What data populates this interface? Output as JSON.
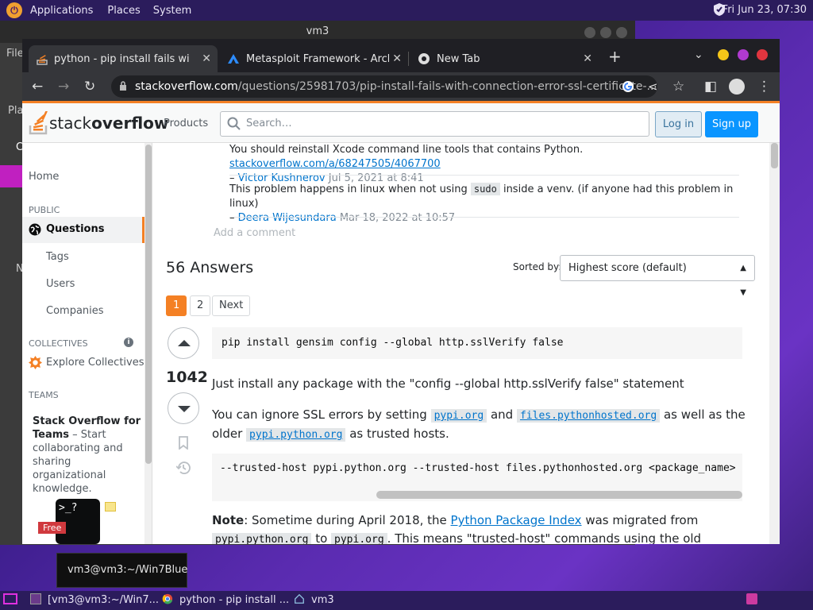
{
  "top_panel": {
    "applications": "Applications",
    "places": "Places",
    "system": "System",
    "clock": "Fri Jun 23, 07:30"
  },
  "vm3_window": {
    "title": "vm3",
    "side_labels": [
      "File",
      "Pla",
      "C",
      "N"
    ]
  },
  "chrome": {
    "tabs": [
      {
        "title": "python - pip install fails with \"c",
        "icon": "stackoverflow-icon"
      },
      {
        "title": "Metasploit Framework - Archi",
        "icon": "metasploit-icon"
      },
      {
        "title": "New Tab",
        "icon": "chrome-icon"
      }
    ],
    "url_host": "stackoverflow.com",
    "url_path": "/questions/25981703/pip-install-fails-with-connection-error-ssl-certificate-..."
  },
  "so": {
    "logo_light": "stack",
    "logo_bold": "overflow",
    "products": "Products",
    "search_placeholder": "Search…",
    "login": "Log in",
    "signup": "Sign up",
    "nav": {
      "home": "Home",
      "public": "PUBLIC",
      "questions": "Questions",
      "tags": "Tags",
      "users": "Users",
      "companies": "Companies",
      "collectives": "COLLECTIVES",
      "explore_collectives": "Explore Collectives",
      "teams": "TEAMS",
      "teams_title": "Stack Overflow for Teams",
      "teams_desc": "– Start collaborating and sharing organizational knowledge.",
      "free": "Free",
      "teams_prompt": ">_?"
    },
    "comments": [
      {
        "text": "You should reinstall Xcode command line tools that contains Python.",
        "link": "stackoverflow.com/a/68247505/4067700",
        "user": "Victor Kushnerov",
        "date": "Jul 5, 2021 at 8:41"
      },
      {
        "text_before": "This problem happens in linux when not using",
        "code": "sudo",
        "text_after": "inside a venv. (if anyone had this problem in linux)",
        "user": "Deera Wijesundara",
        "date": "Mar 18, 2022 at 10:57"
      }
    ],
    "add_comment": "Add a comment",
    "answers_count": "56 Answers",
    "sorted_by": "Sorted by:",
    "sort_value": "Highest score (default)",
    "pager": [
      "1",
      "2",
      "Next"
    ],
    "answer": {
      "score": "1042",
      "code1": "pip install gensim config --global http.sslVerify false",
      "p1": "Just install any package with the \"config --global http.sslVerify false\" statement",
      "p2_a": "You can ignore SSL errors by setting",
      "p2_code1": "pypi.org",
      "p2_and": "and",
      "p2_code2": "files.pythonhosted.org",
      "p2_b": "as well as the older",
      "p2_code3": "pypi.python.org",
      "p2_c": "as trusted hosts.",
      "code2": "--trusted-host pypi.python.org --trusted-host files.pythonhosted.org <package_name>",
      "note_label": "Note",
      "note_a": ": Sometime during April 2018, the",
      "note_link": "Python Package Index",
      "note_b": "was migrated from",
      "note_code1": "pypi.python.org",
      "note_c": "to",
      "note_code2": "pypi.org",
      "note_d": ". This means \"trusted-host\" commands using the old domain no longer work, but you"
    }
  },
  "tooltip": "vm3@vm3:~/Win7Blue",
  "taskbar": {
    "terminal": "[vm3@vm3:~/Win7...",
    "chrome": "python - pip install ...",
    "vm3": "vm3"
  }
}
